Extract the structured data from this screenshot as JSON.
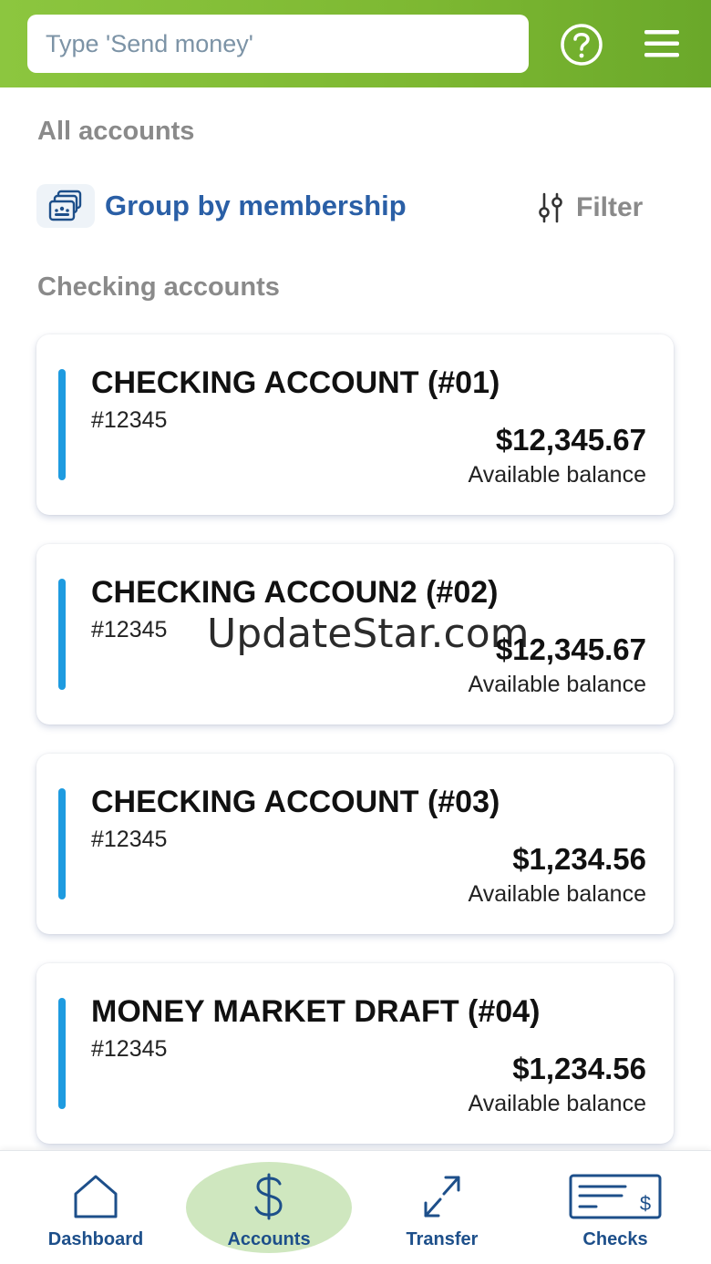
{
  "header": {
    "search_placeholder": "Type 'Send money'"
  },
  "page_title": "All accounts",
  "group_by_label": "Group by membership",
  "filter_label": "Filter",
  "section_title": "Checking accounts",
  "accounts": [
    {
      "name": "CHECKING ACCOUNT (#01)",
      "number": "#12345",
      "balance": "$12,345.67",
      "balance_label": "Available balance"
    },
    {
      "name": "CHECKING ACCOUN2 (#02)",
      "number": "#12345",
      "balance": "$12,345.67",
      "balance_label": "Available balance"
    },
    {
      "name": "CHECKING ACCOUNT (#03)",
      "number": "#12345",
      "balance": "$1,234.56",
      "balance_label": "Available balance"
    },
    {
      "name": "MONEY MARKET DRAFT (#04)",
      "number": "#12345",
      "balance": "$1,234.56",
      "balance_label": "Available balance"
    }
  ],
  "watermark": "UpdateStar.com",
  "nav": {
    "items": [
      {
        "label": "Dashboard",
        "icon": "home-icon"
      },
      {
        "label": "Accounts",
        "icon": "dollar-icon",
        "active": true
      },
      {
        "label": "Transfer",
        "icon": "transfer-arrows-icon"
      },
      {
        "label": "Checks",
        "icon": "check-icon"
      }
    ]
  },
  "colors": {
    "header_green": "#8cc63f",
    "accent_blue": "#2a5fa6",
    "card_bar_blue": "#1e9be0",
    "nav_text": "#1d4f8a",
    "nav_active_bg": "#cfe7bf"
  }
}
